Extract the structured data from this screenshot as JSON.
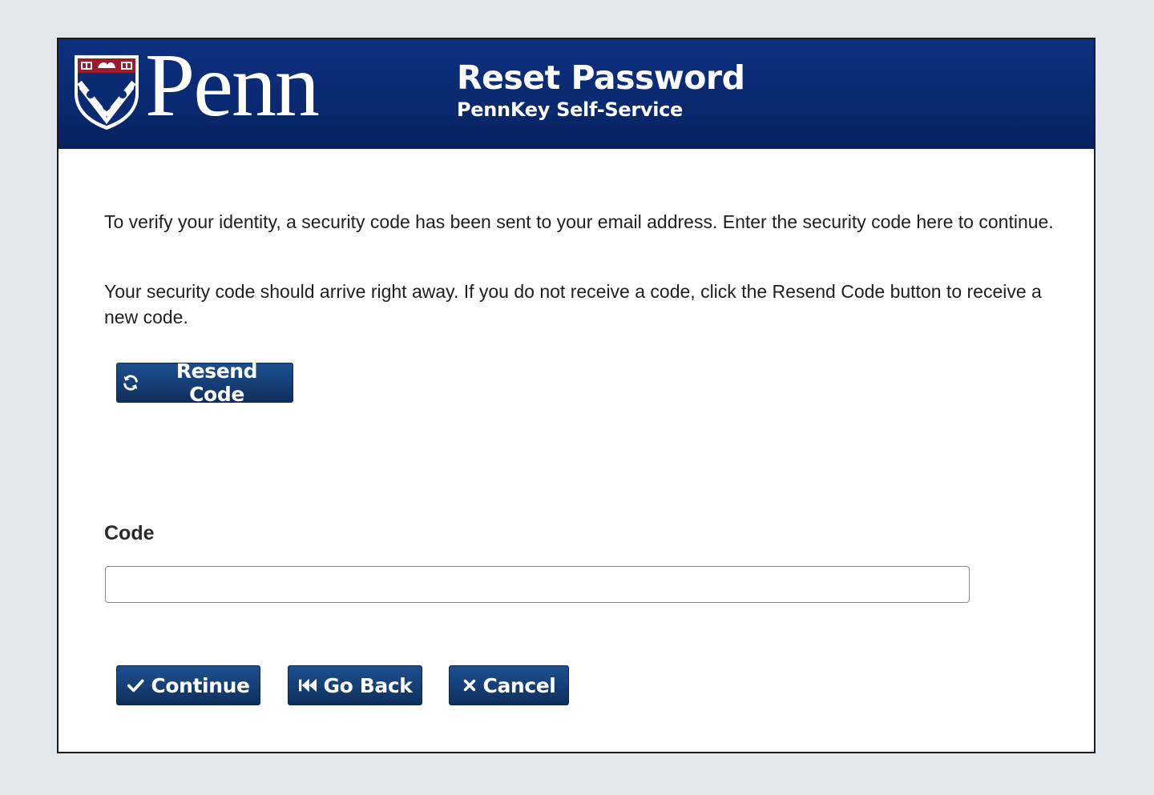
{
  "header": {
    "logo_text": "Penn",
    "title": "Reset Password",
    "subtitle": "PennKey Self-Service"
  },
  "content": {
    "paragraph1": "To verify your identity, a security code has been sent to your email address. Enter the security code here to continue.",
    "paragraph2": "Your security code should arrive right away. If you do not receive a code, click the Resend Code button to receive a new code."
  },
  "resend": {
    "label": "Resend Code",
    "icon": "refresh-icon"
  },
  "form": {
    "code_label": "Code",
    "code_value": "",
    "code_placeholder": ""
  },
  "actions": {
    "continue_label": "Continue",
    "continue_icon": "check-icon",
    "back_label": "Go Back",
    "back_icon": "rewind-icon",
    "cancel_label": "Cancel",
    "cancel_icon": "close-icon"
  },
  "colors": {
    "header_bg": "#0a2a72",
    "button_bg": "#153e75",
    "page_bg": "#e3e8ef"
  }
}
